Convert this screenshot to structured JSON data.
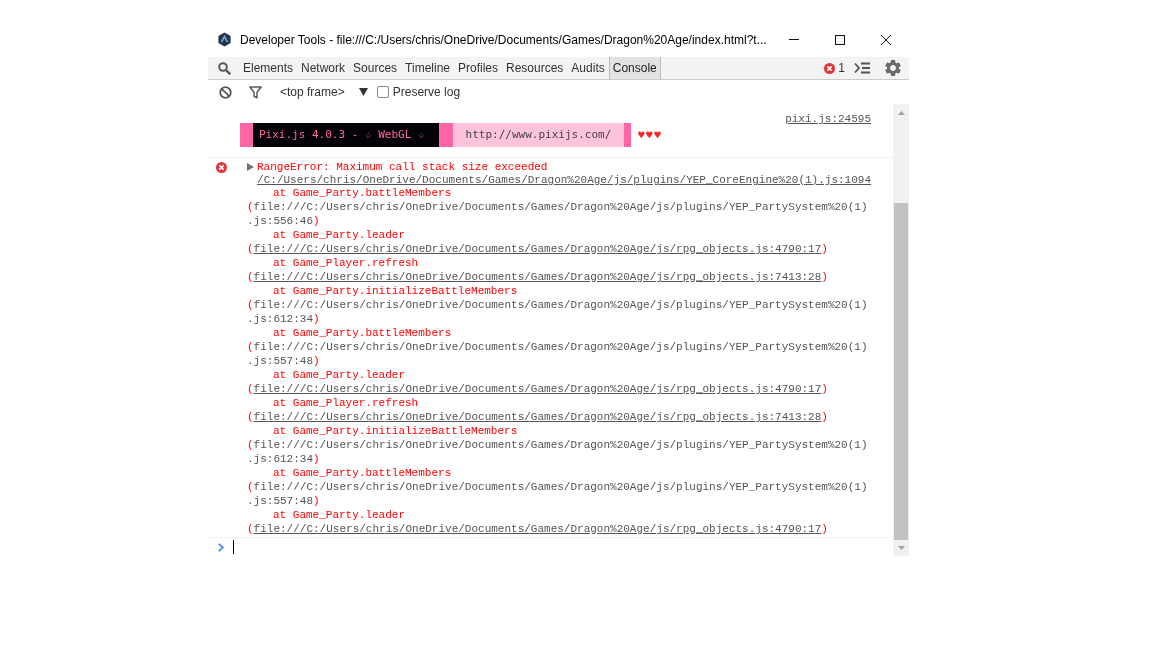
{
  "window": {
    "title": "Developer Tools - file:///C:/Users/chris/OneDrive/Documents/Games/Dragon%20Age/index.html?t..."
  },
  "tabs": [
    {
      "label": "Elements",
      "selected": false
    },
    {
      "label": "Network",
      "selected": false
    },
    {
      "label": "Sources",
      "selected": false
    },
    {
      "label": "Timeline",
      "selected": false
    },
    {
      "label": "Profiles",
      "selected": false
    },
    {
      "label": "Resources",
      "selected": false
    },
    {
      "label": "Audits",
      "selected": false
    },
    {
      "label": "Console",
      "selected": true
    }
  ],
  "error_count": "1",
  "console_toolbar": {
    "context": "<top frame>",
    "preserve_log": {
      "label": "Preserve log",
      "checked": false
    }
  },
  "messages": [
    {
      "kind": "log",
      "source": "pixi.js:24595",
      "banner": [
        {
          "kind": "dark",
          "text": "Pixi.js 4.0.3 - ☆ WebGL ☆"
        },
        {
          "kind": "light",
          "text": "http://www.pixijs.com/"
        }
      ],
      "trailer": "♥♥♥"
    },
    {
      "kind": "error",
      "expanded": false,
      "text": "RangeError: Maximum call stack size exceeded",
      "source": "/C:/Users/chris/OneDrive/Documents/Games/Dragon%20Age/js/plugins/YEP_CoreEngine%20(1).js:1094",
      "stack": [
        {
          "call": "at Game_Party.battleMembers",
          "location": "(file:///C:/Users/chris/OneDrive/Documents/Games/Dragon%20Age/js/plugins/YEP_PartySystem%20(1).js:556:46)",
          "linked": false
        },
        {
          "call": "at Game_Party.leader",
          "location": "(file:///C:/Users/chris/OneDrive/Documents/Games/Dragon%20Age/js/rpg_objects.js:4790:17)",
          "linked": true
        },
        {
          "call": "at Game_Player.refresh",
          "location": "(file:///C:/Users/chris/OneDrive/Documents/Games/Dragon%20Age/js/rpg_objects.js:7413:28)",
          "linked": true
        },
        {
          "call": "at Game_Party.initializeBattleMembers",
          "location": "(file:///C:/Users/chris/OneDrive/Documents/Games/Dragon%20Age/js/plugins/YEP_PartySystem%20(1).js:612:34)",
          "linked": false
        },
        {
          "call": "at Game_Party.battleMembers",
          "location": "(file:///C:/Users/chris/OneDrive/Documents/Games/Dragon%20Age/js/plugins/YEP_PartySystem%20(1).js:557:48)",
          "linked": false
        },
        {
          "call": "at Game_Party.leader",
          "location": "(file:///C:/Users/chris/OneDrive/Documents/Games/Dragon%20Age/js/rpg_objects.js:4790:17)",
          "linked": true
        },
        {
          "call": "at Game_Player.refresh",
          "location": "(file:///C:/Users/chris/OneDrive/Documents/Games/Dragon%20Age/js/rpg_objects.js:7413:28)",
          "linked": true
        },
        {
          "call": "at Game_Party.initializeBattleMembers",
          "location": "(file:///C:/Users/chris/OneDrive/Documents/Games/Dragon%20Age/js/plugins/YEP_PartySystem%20(1).js:612:34)",
          "linked": false
        },
        {
          "call": "at Game_Party.battleMembers",
          "location": "(file:///C:/Users/chris/OneDrive/Documents/Games/Dragon%20Age/js/plugins/YEP_PartySystem%20(1).js:557:48)",
          "linked": false
        },
        {
          "call": "at Game_Party.leader",
          "location": "(file:///C:/Users/chris/OneDrive/Documents/Games/Dragon%20Age/js/rpg_objects.js:4790:17)",
          "linked": true
        }
      ]
    }
  ]
}
